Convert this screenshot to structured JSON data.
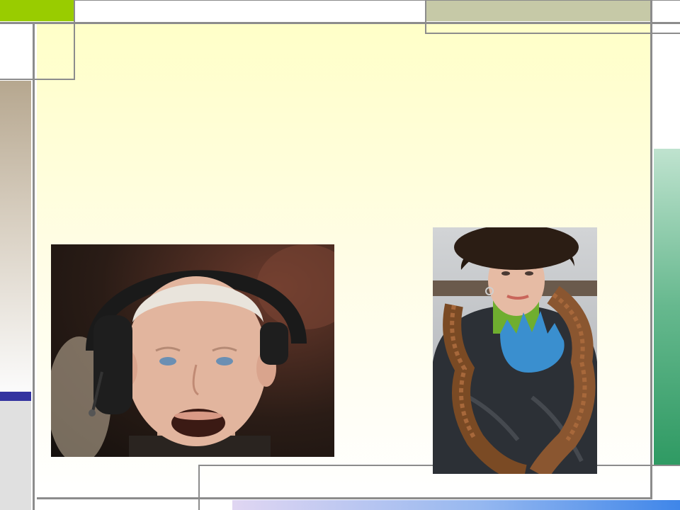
{
  "slide": {
    "images": [
      {
        "icon": "elderly-man-headphones-photo"
      },
      {
        "icon": "elderly-woman-fur-hat-photo"
      }
    ]
  },
  "colors": {
    "accent_green": "#99cc00",
    "khaki": "#c6c9a7",
    "frame_line": "#8c8c8c",
    "content_top": "#ffffc8",
    "right_bar": "#2f9a63",
    "left_marker": "#3333a0"
  }
}
